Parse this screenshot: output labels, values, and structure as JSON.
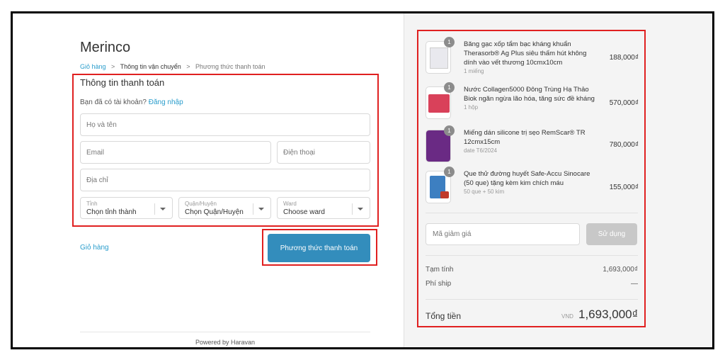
{
  "shop_name": "Merinco",
  "breadcrumb": {
    "cart": "Giỏ hàng",
    "shipping": "Thông tin vận chuyển",
    "payment": "Phương thức thanh toán",
    "separator": ">"
  },
  "form": {
    "title": "Thông tin thanh toán",
    "login_prompt": "Bạn đã có tài khoản?",
    "login_link": "Đăng nhập",
    "fullname_placeholder": "Họ và tên",
    "email_placeholder": "Email",
    "phone_placeholder": "Điện thoại",
    "address_placeholder": "Địa chỉ",
    "province": {
      "label": "Tỉnh",
      "value": "Chọn tỉnh thành"
    },
    "district": {
      "label": "Quận/Huyện",
      "value": "Chọn Quận/Huyện"
    },
    "ward": {
      "label": "Ward",
      "value": "Choose ward"
    }
  },
  "actions": {
    "back_link": "Giỏ hàng",
    "continue_button": "Phương thức thanh toán"
  },
  "footer": "Powered by Haravan",
  "order": {
    "items": [
      {
        "name": "Băng gạc xốp tẩm bạc kháng khuẩn Therasorb® Ag Plus siêu thấm hút không dính vào vết thương 10cmx10cm",
        "variant": "1 miếng",
        "qty": "1",
        "price": "188,000₫",
        "thumb_color": "#e9e9ee"
      },
      {
        "name": "Nước Collagen5000 Đông Trùng Hạ Thảo Biok ngăn ngừa lão hóa, tăng sức đề kháng",
        "variant": "1 hộp",
        "qty": "1",
        "price": "570,000₫",
        "thumb_color": "#d9415a"
      },
      {
        "name": "Miếng dán silicone trị sẹo RemScar® TR 12cmx15cm",
        "variant": "date T6/2024",
        "qty": "1",
        "price": "780,000₫",
        "thumb_color": "#6a2a84"
      },
      {
        "name": "Que thử đường huyết Safe-Accu Sinocare (50 que) tặng kèm kim chích máu",
        "variant": "50 que + 50 kim",
        "qty": "1",
        "price": "155,000₫",
        "thumb_color": "#3d7fc1"
      }
    ],
    "discount_placeholder": "Mã giảm giá",
    "apply_button": "Sử dụng",
    "subtotal_label": "Tạm tính",
    "subtotal_value": "1,693,000₫",
    "shipping_label": "Phí ship",
    "shipping_value": "—",
    "total_label": "Tổng tiền",
    "total_currency": "VND",
    "total_value": "1,693,000₫"
  },
  "colors": {
    "accent": "#338dbc",
    "link": "#2a9dcc",
    "highlight_border": "#e02020"
  }
}
